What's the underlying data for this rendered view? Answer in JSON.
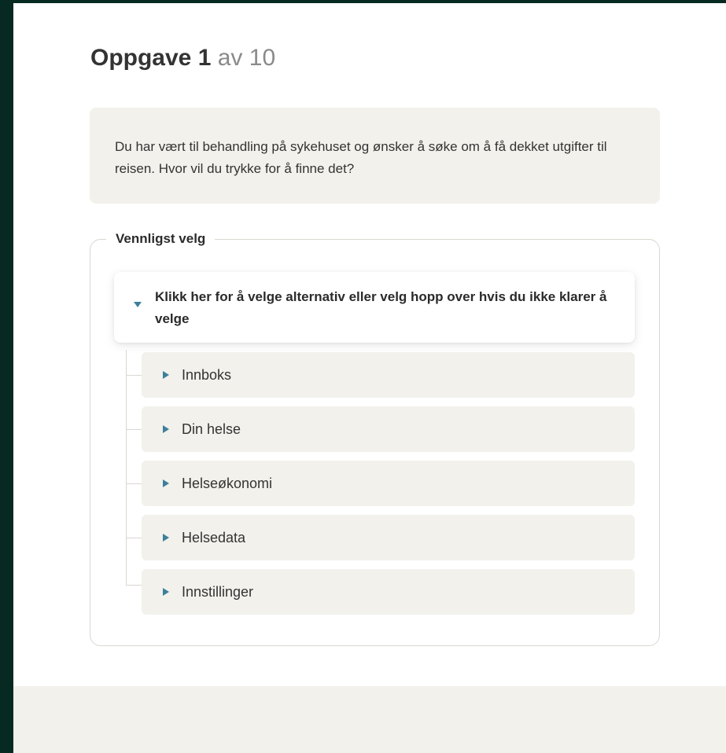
{
  "task": {
    "title_strong": "Oppgave 1",
    "title_muted": "av 10",
    "question": "Du har vært til behandling på sykehuset og ønsker å søke om å få dekket utgifter til reisen. Hvor vil du trykke for å finne det?"
  },
  "selection": {
    "legend": "Vennligst velg",
    "main_option": "Klikk her for å velge alternativ eller velg hopp over hvis du ikke klarer å velge",
    "options": [
      {
        "label": "Innboks"
      },
      {
        "label": "Din helse"
      },
      {
        "label": "Helseøkonomi"
      },
      {
        "label": "Helsedata"
      },
      {
        "label": "Innstillinger"
      }
    ]
  },
  "colors": {
    "accent": "#3d7f9a",
    "panel": "#f2f1ec",
    "frame": "#062a22"
  },
  "icons": {
    "expanded": "caret-down-icon",
    "collapsed": "caret-right-icon"
  }
}
